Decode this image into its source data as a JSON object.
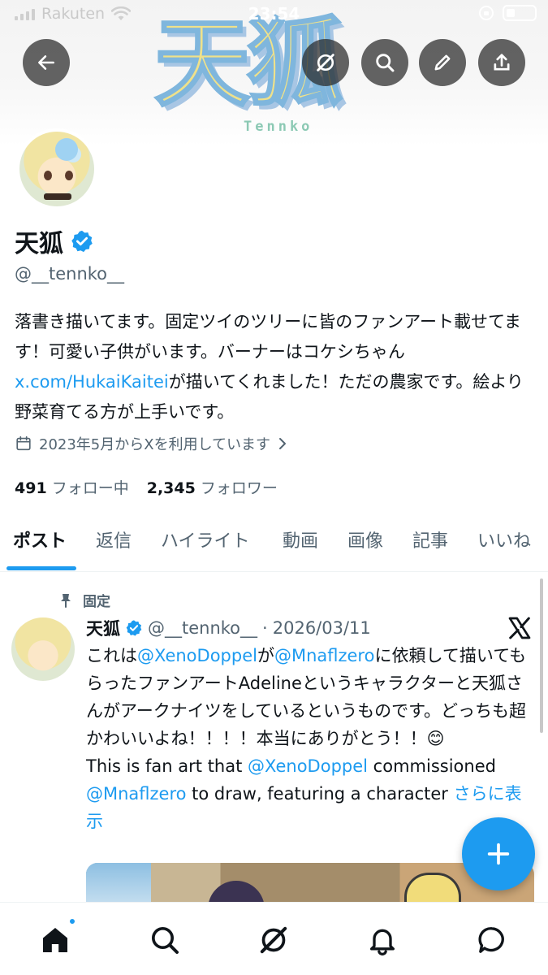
{
  "status_bar": {
    "carrier": "Rakuten",
    "time": "23:54"
  },
  "banner": {
    "logo_text": "天狐",
    "logo_subtext": "Tennko"
  },
  "top_actions": [
    "back-arrow-icon",
    "grok-icon",
    "search-icon",
    "edit-icon",
    "share-icon"
  ],
  "profile": {
    "display_name": "天狐",
    "handle": "@__tennko__",
    "bio_part1": "落書き描いてます。固定ツイのツリーに皆のファンアート載せてます！可愛い子供がいます。バーナーはコケシちゃん",
    "bio_link": "x.com/HukaiKaitei",
    "bio_part2": "が描いてくれました！ただの農家です。絵より野菜育てる方が上手いです。",
    "joined": "2023年5月からXを利用しています",
    "following_count": "491",
    "following_label": "フォロー中",
    "followers_count": "2,345",
    "followers_label": "フォロワー"
  },
  "tabs": [
    "ポスト",
    "返信",
    "ハイライト",
    "動画",
    "画像",
    "記事",
    "いいね"
  ],
  "active_tab": "ポスト",
  "post": {
    "pinned_label": "固定",
    "author_name": "天狐",
    "author_handle": "@__tennko__",
    "separator": "·",
    "date": "2026/03/11",
    "text_1": "これは",
    "mention_1": "@XenoDoppel",
    "text_2": "が",
    "mention_2": "@Mnaflzero",
    "text_3": "に依頼して描いてもらったファンアートAdelineというキャラクターと天狐さんがアークナイツをしているというものです。どっちも超かわいいよね！！！！本当にありがとう！！😊",
    "text_4": "This is fan art that ",
    "mention_3": "@XenoDoppel",
    "text_5": " commissioned ",
    "mention_4": "@Mnaflzero",
    "text_6": " to draw, featuring a character ",
    "show_more": "さらに表示"
  },
  "bottom_nav": [
    "home-icon",
    "search-icon",
    "grok-icon",
    "notifications-icon",
    "messages-icon"
  ],
  "colors": {
    "accent": "#1d9bf0",
    "text": "#0f1419",
    "secondary": "#536471"
  }
}
